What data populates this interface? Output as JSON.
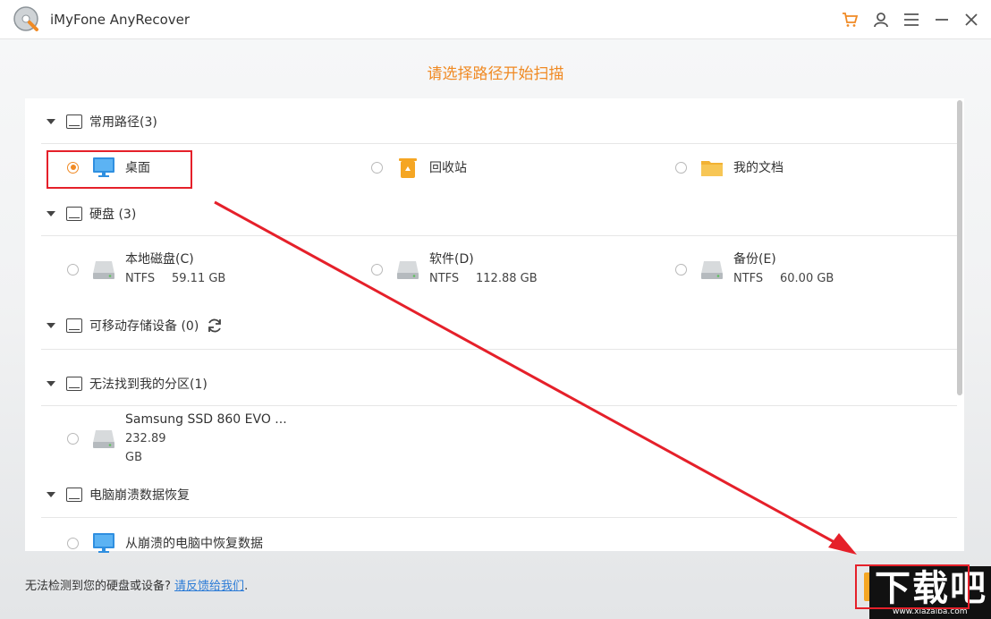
{
  "window": {
    "title": "iMyFone AnyRecover"
  },
  "heading": "请选择路径开始扫描",
  "sections": [
    {
      "label": "常用路径(3)"
    },
    {
      "label": "硬盘 (3)"
    },
    {
      "label": "可移动存储设备 (0)"
    },
    {
      "label": "无法找到我的分区(1)"
    },
    {
      "label": "电脑崩溃数据恢复"
    }
  ],
  "common_paths": [
    {
      "label": "桌面",
      "icon": "desktop-monitor-icon",
      "selected": true
    },
    {
      "label": "回收站",
      "icon": "recycle-bin-icon",
      "selected": false
    },
    {
      "label": "我的文档",
      "icon": "folder-icon",
      "selected": false
    }
  ],
  "drives": [
    {
      "name": "本地磁盘(C)",
      "fs": "NTFS",
      "size": "59.11 GB"
    },
    {
      "name": "软件(D)",
      "fs": "NTFS",
      "size": "112.88 GB"
    },
    {
      "name": "备份(E)",
      "fs": "NTFS",
      "size": "60.00 GB"
    }
  ],
  "lost_partition": {
    "name": "Samsung SSD 860 EVO ...",
    "size": "232.89 GB"
  },
  "crash_recovery": {
    "label": "从崩溃的电脑中恢复数据"
  },
  "footer": {
    "text": "无法检测到您的硬盘或设备?",
    "link": "请反馈给我们",
    "period": "."
  },
  "watermark": {
    "big": "下载吧",
    "small": "www.xiazaiba.com"
  },
  "colors": {
    "accent": "#f08a24",
    "annotation": "#e5202a",
    "link": "#2b7bd6"
  }
}
